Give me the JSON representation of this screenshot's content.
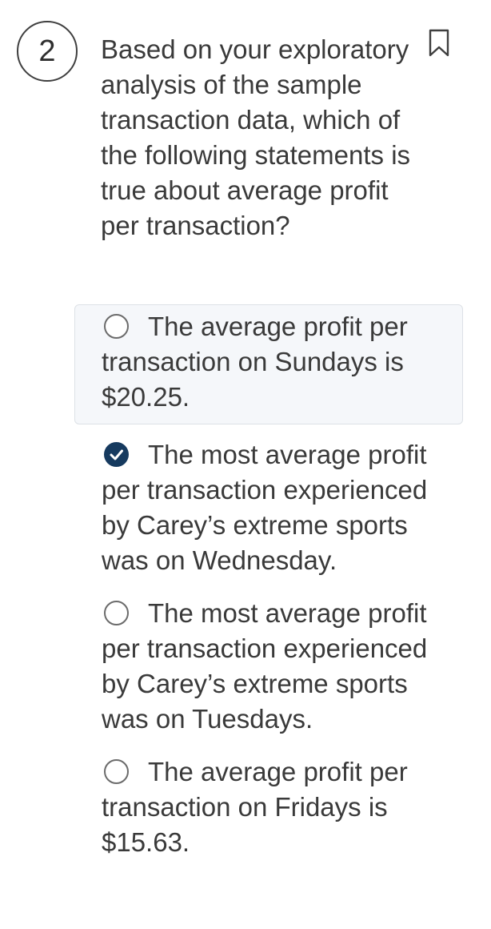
{
  "question": {
    "number": "2",
    "text": "Based on your exploratory analysis of the sample transaction data, which of the following statements is true about average profit per transaction?",
    "bookmark_icon": "bookmark-icon"
  },
  "options": [
    {
      "label": "The average profit per transaction on Sundays is $20.25.",
      "selected": false
    },
    {
      "label": "The most average profit per transaction experienced by Carey’s extreme sports was on Wednesday.",
      "selected": true
    },
    {
      "label": "The most average profit per transaction experienced by Carey’s extreme sports was on Tuesdays.",
      "selected": false
    },
    {
      "label": "The average profit per transaction on Fridays is $15.63.",
      "selected": false
    }
  ],
  "colors": {
    "selected_radio": "#163a5f",
    "hover_background": "#f5f7fa"
  }
}
